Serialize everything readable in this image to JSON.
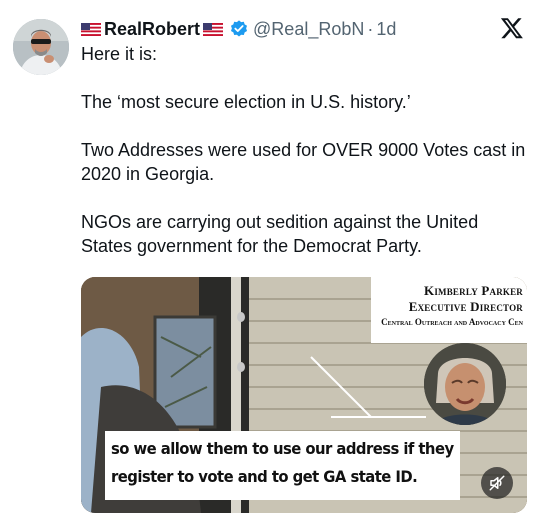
{
  "tweet": {
    "display_name": "RealRobert",
    "handle": "@Real_RobN",
    "separator": "·",
    "time": "1d",
    "paragraphs": [
      "Here it is:",
      "The ‘most secure election in U.S. history.’",
      "Two Addresses were used for OVER 9000 Votes cast in 2020 in Georgia.",
      "NGOs are carrying out sedition against the United States government for the Democrat Party."
    ]
  },
  "icons": {
    "avatar": "avatar",
    "flags": "us-flag-icon",
    "verified": "verified-badge-icon",
    "platform": "x-logo-icon",
    "mute": "muted-speaker-icon"
  },
  "colors": {
    "verified": "#1d9bf0",
    "secondary_text": "#536471"
  },
  "video": {
    "lower_third": {
      "name": "Kimberly Parker",
      "title": "Executive Director",
      "org": "Central Outreach and Advocacy Cen"
    },
    "caption_lines": [
      "so we allow them to use our address if they",
      "register to vote and to get GA state ID."
    ]
  }
}
